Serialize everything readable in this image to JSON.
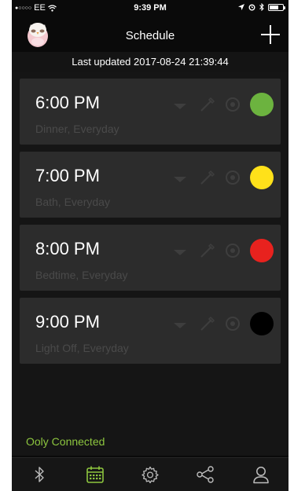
{
  "status_bar": {
    "carrier": "EE",
    "time": "9:39 PM"
  },
  "nav": {
    "title": "Schedule",
    "add_icon": "plus-icon",
    "avatar_icon": "owl-night-light-icon"
  },
  "last_updated": "Last updated 2017-08-24 21:39:44",
  "schedules": [
    {
      "time": "6:00 PM",
      "subtitle": "Dinner, Everyday",
      "color": "#6cb33f"
    },
    {
      "time": "7:00 PM",
      "subtitle": "Bath, Everyday",
      "color": "#ffe11a"
    },
    {
      "time": "8:00 PM",
      "subtitle": "Bedtime, Everyday",
      "color": "#e8221e"
    },
    {
      "time": "9:00 PM",
      "subtitle": "Light Off, Everyday",
      "color": "#000000"
    }
  ],
  "connection_status": "Ooly Connected",
  "colors": {
    "accent_green": "#8dc63f",
    "background": "#0a0a0a",
    "card": "#2c2c2c"
  },
  "tabs": [
    {
      "icon": "bluetooth-icon",
      "active": false
    },
    {
      "icon": "calendar-icon",
      "active": true
    },
    {
      "icon": "settings-gear-icon",
      "active": false
    },
    {
      "icon": "share-icon",
      "active": false
    },
    {
      "icon": "user-icon",
      "active": false
    }
  ]
}
